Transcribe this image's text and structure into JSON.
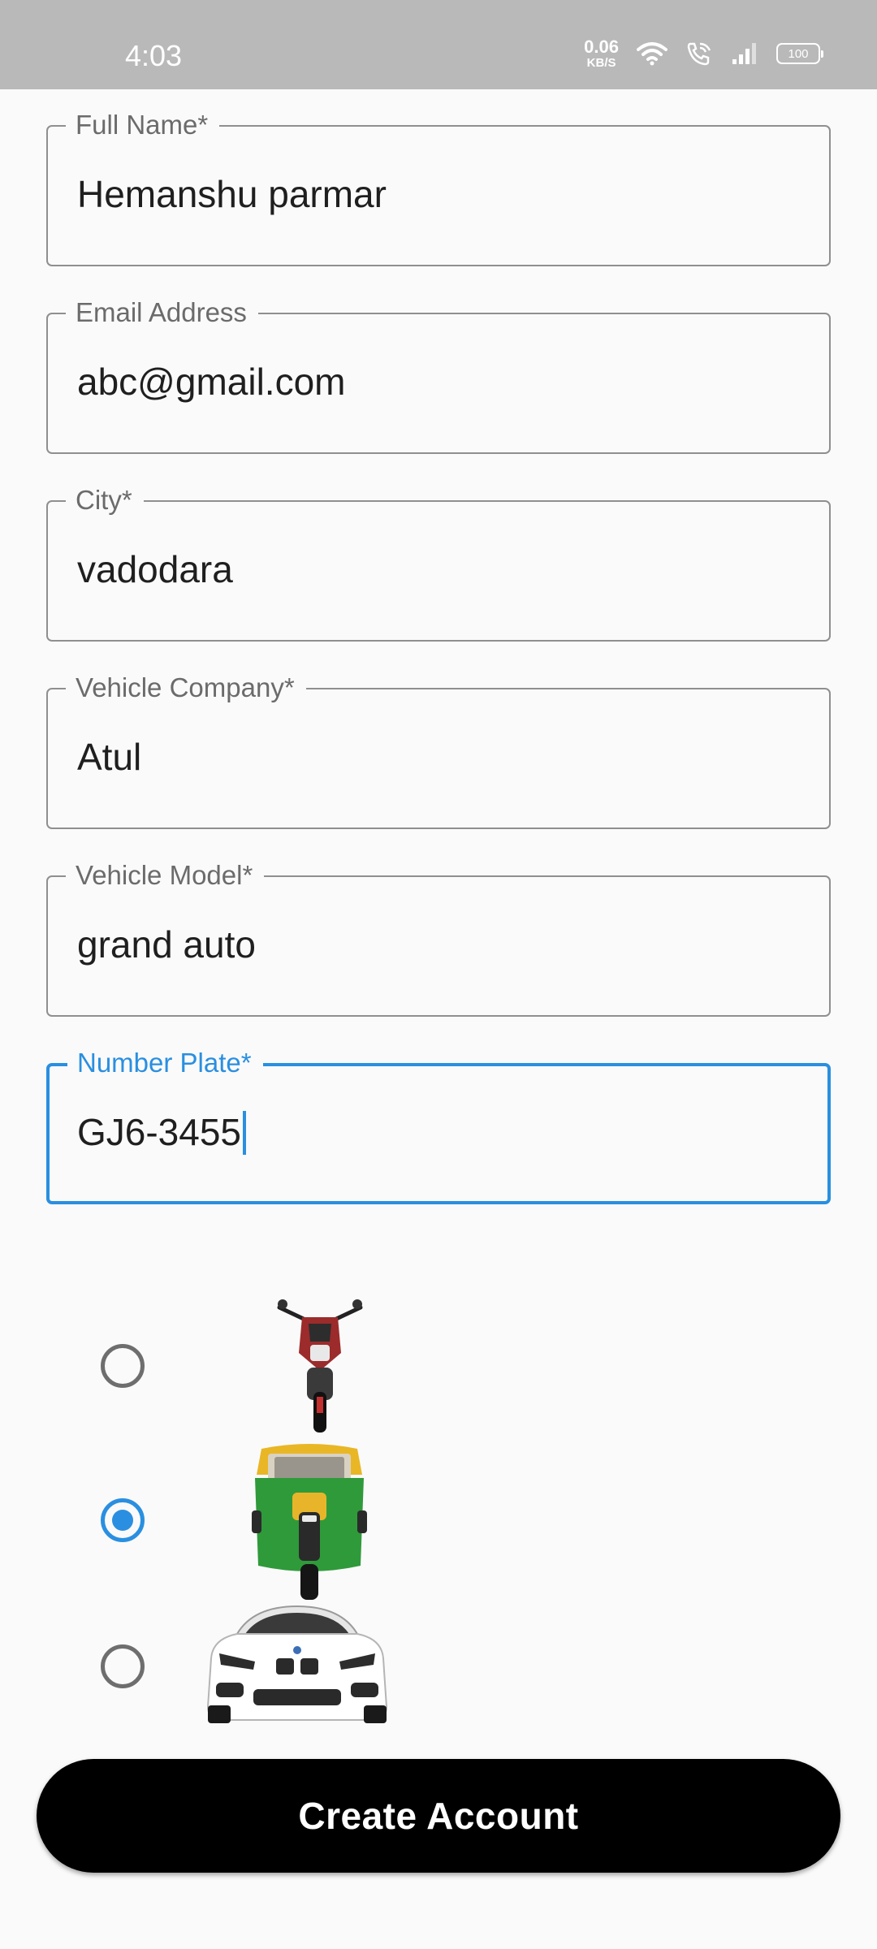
{
  "status_bar": {
    "time": "4:03",
    "net_speed_value": "0.06",
    "net_speed_unit": "KB/S",
    "battery": "100",
    "icons": [
      "wifi-icon",
      "wifi-calling-icon",
      "signal-icon",
      "battery-icon"
    ]
  },
  "form": {
    "full_name": {
      "label": "Full Name*",
      "value": "Hemanshu parmar"
    },
    "email": {
      "label": "Email Address",
      "value": "abc@gmail.com"
    },
    "city": {
      "label": "City*",
      "value": "vadodara"
    },
    "vehicle_company": {
      "label": "Vehicle Company*",
      "value": "Atul"
    },
    "vehicle_model": {
      "label": "Vehicle Model*",
      "value": "grand auto"
    },
    "number_plate": {
      "label": "Number Plate*",
      "value": "GJ6-3455"
    }
  },
  "vehicle_options": [
    {
      "name": "motorbike",
      "selected": false
    },
    {
      "name": "auto-rickshaw",
      "selected": true
    },
    {
      "name": "car",
      "selected": false
    }
  ],
  "actions": {
    "create_account_label": "Create Account"
  },
  "colors": {
    "accent": "#2a8fe0",
    "button": "#000000",
    "status_bar": "#b9b9b9",
    "border": "#8f8f8f"
  }
}
